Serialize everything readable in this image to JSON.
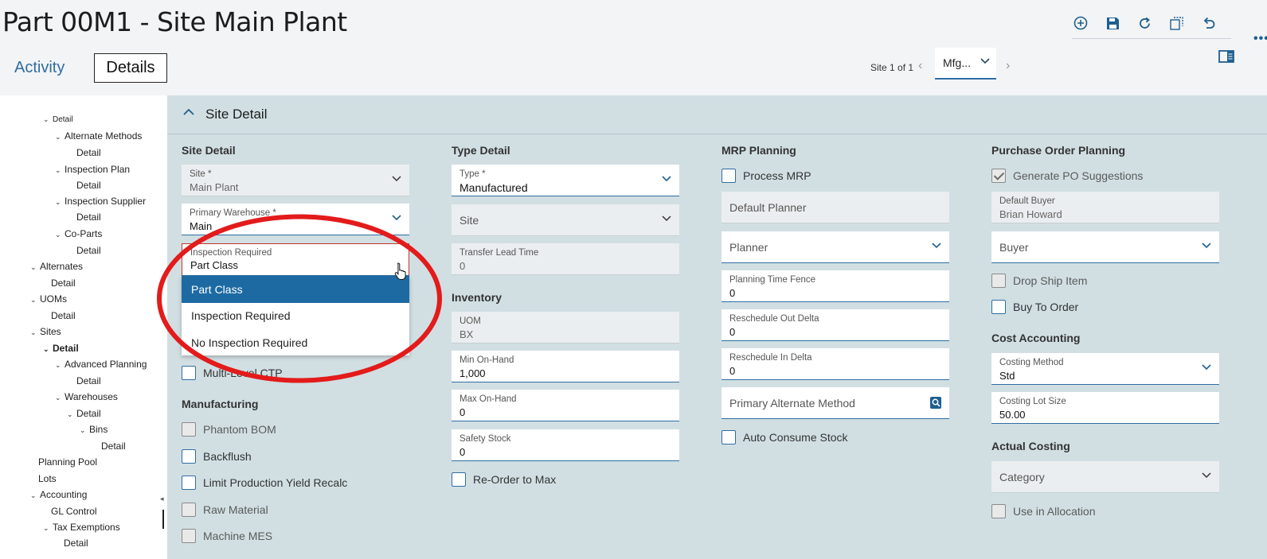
{
  "header": {
    "title": "Part 00M1 - Site Main Plant",
    "tabs": [
      {
        "label": "Activity"
      },
      {
        "label": "Details"
      }
    ],
    "site_counter": "Site 1 of 1",
    "site_select_value": "Mfg..."
  },
  "toolbar": {
    "icons": [
      "add-icon",
      "save-icon",
      "refresh-icon",
      "copy-icon",
      "undo-icon"
    ]
  },
  "tree": {
    "items": [
      {
        "label": "Detail"
      },
      {
        "label": "Alternate Methods"
      },
      {
        "label": "Detail"
      },
      {
        "label": "Inspection Plan"
      },
      {
        "label": "Detail"
      },
      {
        "label": "Inspection Supplier"
      },
      {
        "label": "Detail"
      },
      {
        "label": "Co-Parts"
      },
      {
        "label": "Detail"
      },
      {
        "label": "Alternates"
      },
      {
        "label": "Detail"
      },
      {
        "label": "UOMs"
      },
      {
        "label": "Detail"
      },
      {
        "label": "Sites"
      },
      {
        "label": "Detail"
      },
      {
        "label": "Advanced Planning"
      },
      {
        "label": "Detail"
      },
      {
        "label": "Warehouses"
      },
      {
        "label": "Detail"
      },
      {
        "label": "Bins"
      },
      {
        "label": "Detail"
      },
      {
        "label": "Planning Pool"
      },
      {
        "label": "Lots"
      },
      {
        "label": "Accounting"
      },
      {
        "label": "GL Control"
      },
      {
        "label": "Tax Exemptions"
      },
      {
        "label": "Detail"
      }
    ]
  },
  "section": {
    "title": "Site Detail"
  },
  "site_detail": {
    "title": "Site Detail",
    "site_label": "Site *",
    "site_value": "Main Plant",
    "warehouse_label": "Primary Warehouse *",
    "warehouse_value": "Main",
    "inspection_label": "Inspection Required",
    "inspection_value": "Part Class",
    "inspection_options": [
      "Part Class",
      "Inspection Required",
      "No Inspection Required"
    ],
    "multi_level_ctp": "Multi-Level CTP"
  },
  "manufacturing": {
    "title": "Manufacturing",
    "phantom_bom": "Phantom BOM",
    "backflush": "Backflush",
    "limit_yield": "Limit Production Yield Recalc",
    "raw_material": "Raw Material",
    "machine_mes": "Machine MES"
  },
  "type_detail": {
    "title": "Type Detail",
    "type_label": "Type *",
    "type_value": "Manufactured",
    "site_placeholder": "Site",
    "transfer_label": "Transfer Lead Time",
    "transfer_value": "0"
  },
  "inventory": {
    "title": "Inventory",
    "uom_label": "UOM",
    "uom_value": "BX",
    "min_label": "Min On-Hand",
    "min_value": "1,000",
    "max_label": "Max On-Hand",
    "max_value": "0",
    "safety_label": "Safety Stock",
    "safety_value": "0",
    "reorder_to_max": "Re-Order to Max"
  },
  "mrp": {
    "title": "MRP Planning",
    "process_mrp": "Process MRP",
    "default_planner": "Default Planner",
    "planner_placeholder": "Planner",
    "time_fence_label": "Planning Time Fence",
    "time_fence_value": "0",
    "out_delta_label": "Reschedule Out Delta",
    "out_delta_value": "0",
    "in_delta_label": "Reschedule In Delta",
    "in_delta_value": "0",
    "primary_alt_method": "Primary Alternate Method",
    "auto_consume": "Auto Consume Stock"
  },
  "po_planning": {
    "title": "Purchase Order Planning",
    "generate_po": "Generate PO Suggestions",
    "default_buyer_label": "Default Buyer",
    "default_buyer_value": "Brian Howard",
    "buyer_placeholder": "Buyer",
    "drop_ship": "Drop Ship Item",
    "buy_to_order": "Buy To Order"
  },
  "cost_accounting": {
    "title": "Cost Accounting",
    "method_label": "Costing Method",
    "method_value": "Std",
    "lot_label": "Costing Lot Size",
    "lot_value": "50.00"
  },
  "actual_costing": {
    "title": "Actual Costing",
    "category_placeholder": "Category",
    "use_in_allocation": "Use in Allocation"
  },
  "colors": {
    "accent": "#2f6da3",
    "selected_option": "#1d6aa3",
    "panel_bg": "#d1dfe3",
    "annotation_red": "#e31b1b"
  }
}
